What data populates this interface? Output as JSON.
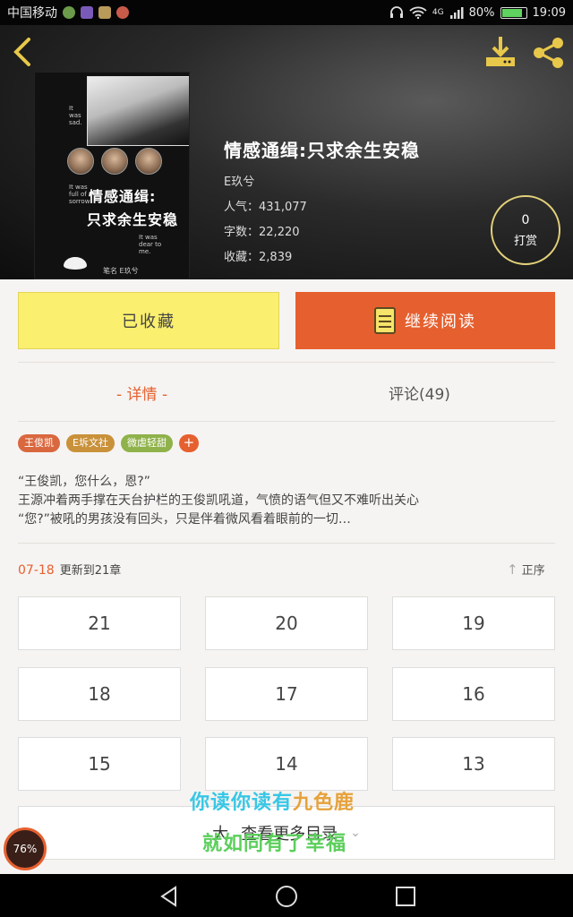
{
  "status_bar": {
    "carrier": "中国移动",
    "network": "4G",
    "battery": "80%",
    "battery_level": 0.8,
    "time": "19:09"
  },
  "book": {
    "title": "情感通缉:只求余生安稳",
    "author": "E玖兮",
    "stats": [
      {
        "label": "人气：",
        "value": "431,077"
      },
      {
        "label": "字数：",
        "value": "22,220"
      },
      {
        "label": "收藏：",
        "value": "2,839"
      }
    ],
    "tip_count": "0",
    "tip_label": "打赏"
  },
  "cover": {
    "title_line1": "情感通缉:",
    "title_line2": "只求余生安稳",
    "text_1": "It was sad.",
    "text_2": "It was full of sorrow",
    "text_3": "It was dear to me.",
    "author_line": "笔名  E玖兮"
  },
  "actions": {
    "collect_label": "已收藏",
    "read_label": "继续阅读"
  },
  "tabs": {
    "detail": "- 详情 -",
    "comments": "评论(49)"
  },
  "tags": [
    {
      "label": "王俊凯",
      "color": "#d9683f"
    },
    {
      "label": "E坼文社",
      "color": "#c9913a"
    },
    {
      "label": "微虐轻甜",
      "color": "#8fb24a"
    }
  ],
  "synopsis": [
    "“王俊凯，您什么，恩?”",
    "王源冲着两手撑在天台护栏的王俊凯吼道，气愤的语气但又不难听出关心",
    "“您?”被吼的男孩没有回头，只是伴着微风看着眼前的一切…"
  ],
  "chapters_info": {
    "date": "07-18",
    "update_text": "更新到21章",
    "sort_label": "正序"
  },
  "chapters": [
    "21",
    "20",
    "19",
    "18",
    "17",
    "16",
    "15",
    "14",
    "13"
  ],
  "more": {
    "label_a": "大",
    "label_b": "查看更多目录"
  },
  "watermark": {
    "line1_a": "你读你读有",
    "line1_b": "九色鹿",
    "line2": "就如同有了幸福"
  },
  "speed_badge": "76%",
  "colors": {
    "accent": "#e6602f",
    "collect_bg": "#faef6e",
    "icon_gold": "#e8c84a"
  }
}
